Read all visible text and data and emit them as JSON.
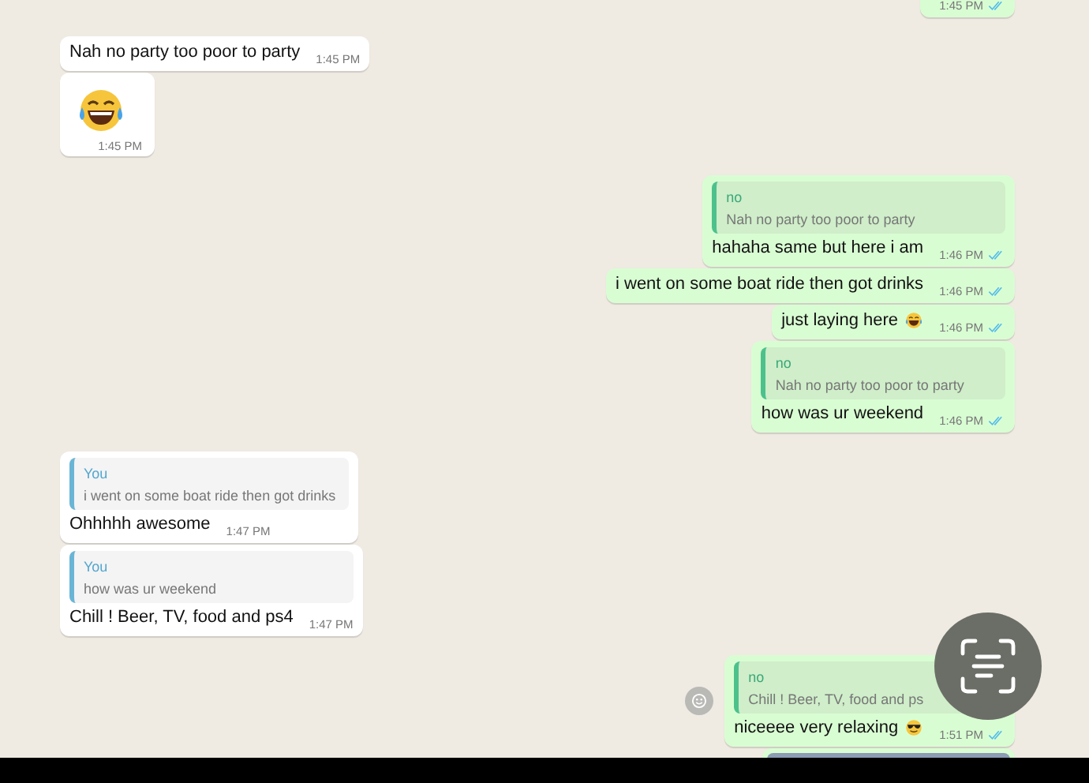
{
  "messages": [
    {
      "outgoing": true,
      "kind": "text",
      "time": "1:45 PM",
      "read": true
    },
    {
      "outgoing": false,
      "kind": "text",
      "text": "Nah no party too poor to party",
      "time": "1:45 PM"
    },
    {
      "outgoing": false,
      "kind": "emoji",
      "icon": {
        "kind": "laughing"
      },
      "time": "1:45 PM"
    },
    {
      "outgoing": true,
      "kind": "text",
      "quote": {
        "author": "no",
        "text": "Nah no party too poor to party"
      },
      "text": "hahaha same but here i am",
      "time": "1:46 PM",
      "read": true
    },
    {
      "outgoing": true,
      "kind": "text",
      "text": "i went on some boat ride then got drinks",
      "time": "1:46 PM",
      "read": true
    },
    {
      "outgoing": true,
      "kind": "text",
      "text": "just laying here",
      "icon": {
        "kind": "laughing"
      },
      "time": "1:46 PM",
      "read": true
    },
    {
      "outgoing": true,
      "kind": "text",
      "quote": {
        "author": "no",
        "text": "Nah no party too poor to party"
      },
      "text": "how was ur weekend",
      "time": "1:46 PM",
      "read": true
    },
    {
      "outgoing": false,
      "kind": "text",
      "quote": {
        "author": "You",
        "text": "i went on some boat ride then got drinks"
      },
      "text": "Ohhhhh awesome",
      "time": "1:47 PM"
    },
    {
      "outgoing": false,
      "kind": "text",
      "quote": {
        "author": "You",
        "text": "how was ur weekend"
      },
      "text": "Chill ! Beer, TV, food and ps4",
      "time": "1:47 PM"
    },
    {
      "outgoing": true,
      "kind": "text",
      "quote": {
        "author": "no",
        "text": "Chill ! Beer, TV, food and ps"
      },
      "text": "niceeee very relaxing",
      "icon": {
        "kind": "sunglasses"
      },
      "time": "1:51 PM",
      "read": true,
      "reaction_button": true
    },
    {
      "outgoing": true,
      "kind": "photo"
    }
  ]
}
